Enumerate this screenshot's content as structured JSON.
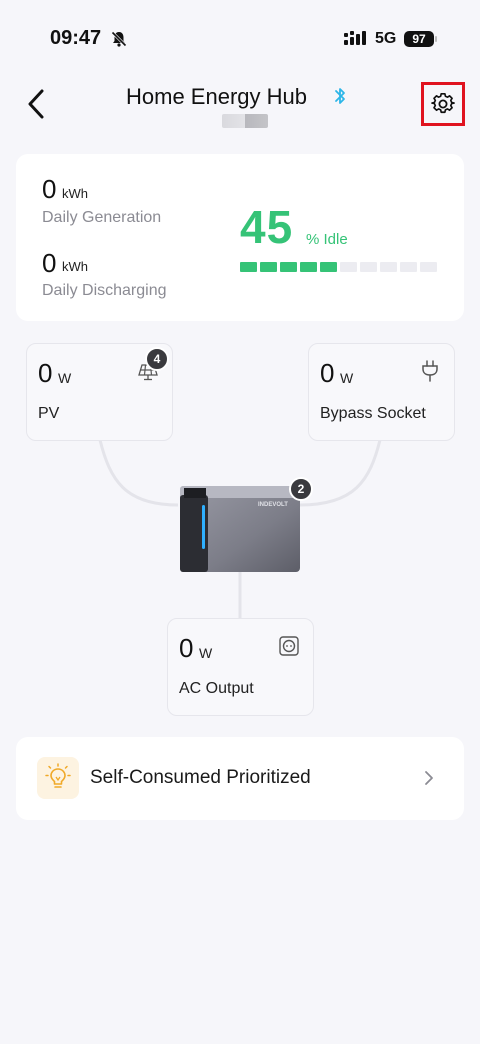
{
  "status_bar": {
    "time": "09:47",
    "network": "5G",
    "battery": "97"
  },
  "header": {
    "title": "Home Energy Hub"
  },
  "summary": {
    "daily_generation": {
      "value": "0",
      "unit": "kWh",
      "label": "Daily Generation"
    },
    "daily_discharging": {
      "value": "0",
      "unit": "kWh",
      "label": "Daily Discharging"
    },
    "battery_level": "45",
    "battery_status": "% Idle",
    "battery_level_fraction": 0.45,
    "colors": {
      "accent": "#35c377",
      "bar_empty": "#ececf1"
    }
  },
  "flow": {
    "pv": {
      "value": "0",
      "unit": "W",
      "label": "PV",
      "badge": "4",
      "icon": "solar-panel-icon"
    },
    "bypass": {
      "value": "0",
      "unit": "W",
      "label": "Bypass Socket",
      "icon": "plug-icon"
    },
    "device": {
      "brand": "INDEVOLT",
      "badge": "2"
    },
    "ac_output": {
      "value": "0",
      "unit": "W",
      "label": "AC Output",
      "icon": "outlet-icon"
    }
  },
  "mode": {
    "label": "Self-Consumed Prioritized",
    "icon": "lightbulb-icon"
  },
  "highlight_color": "#e0131f"
}
